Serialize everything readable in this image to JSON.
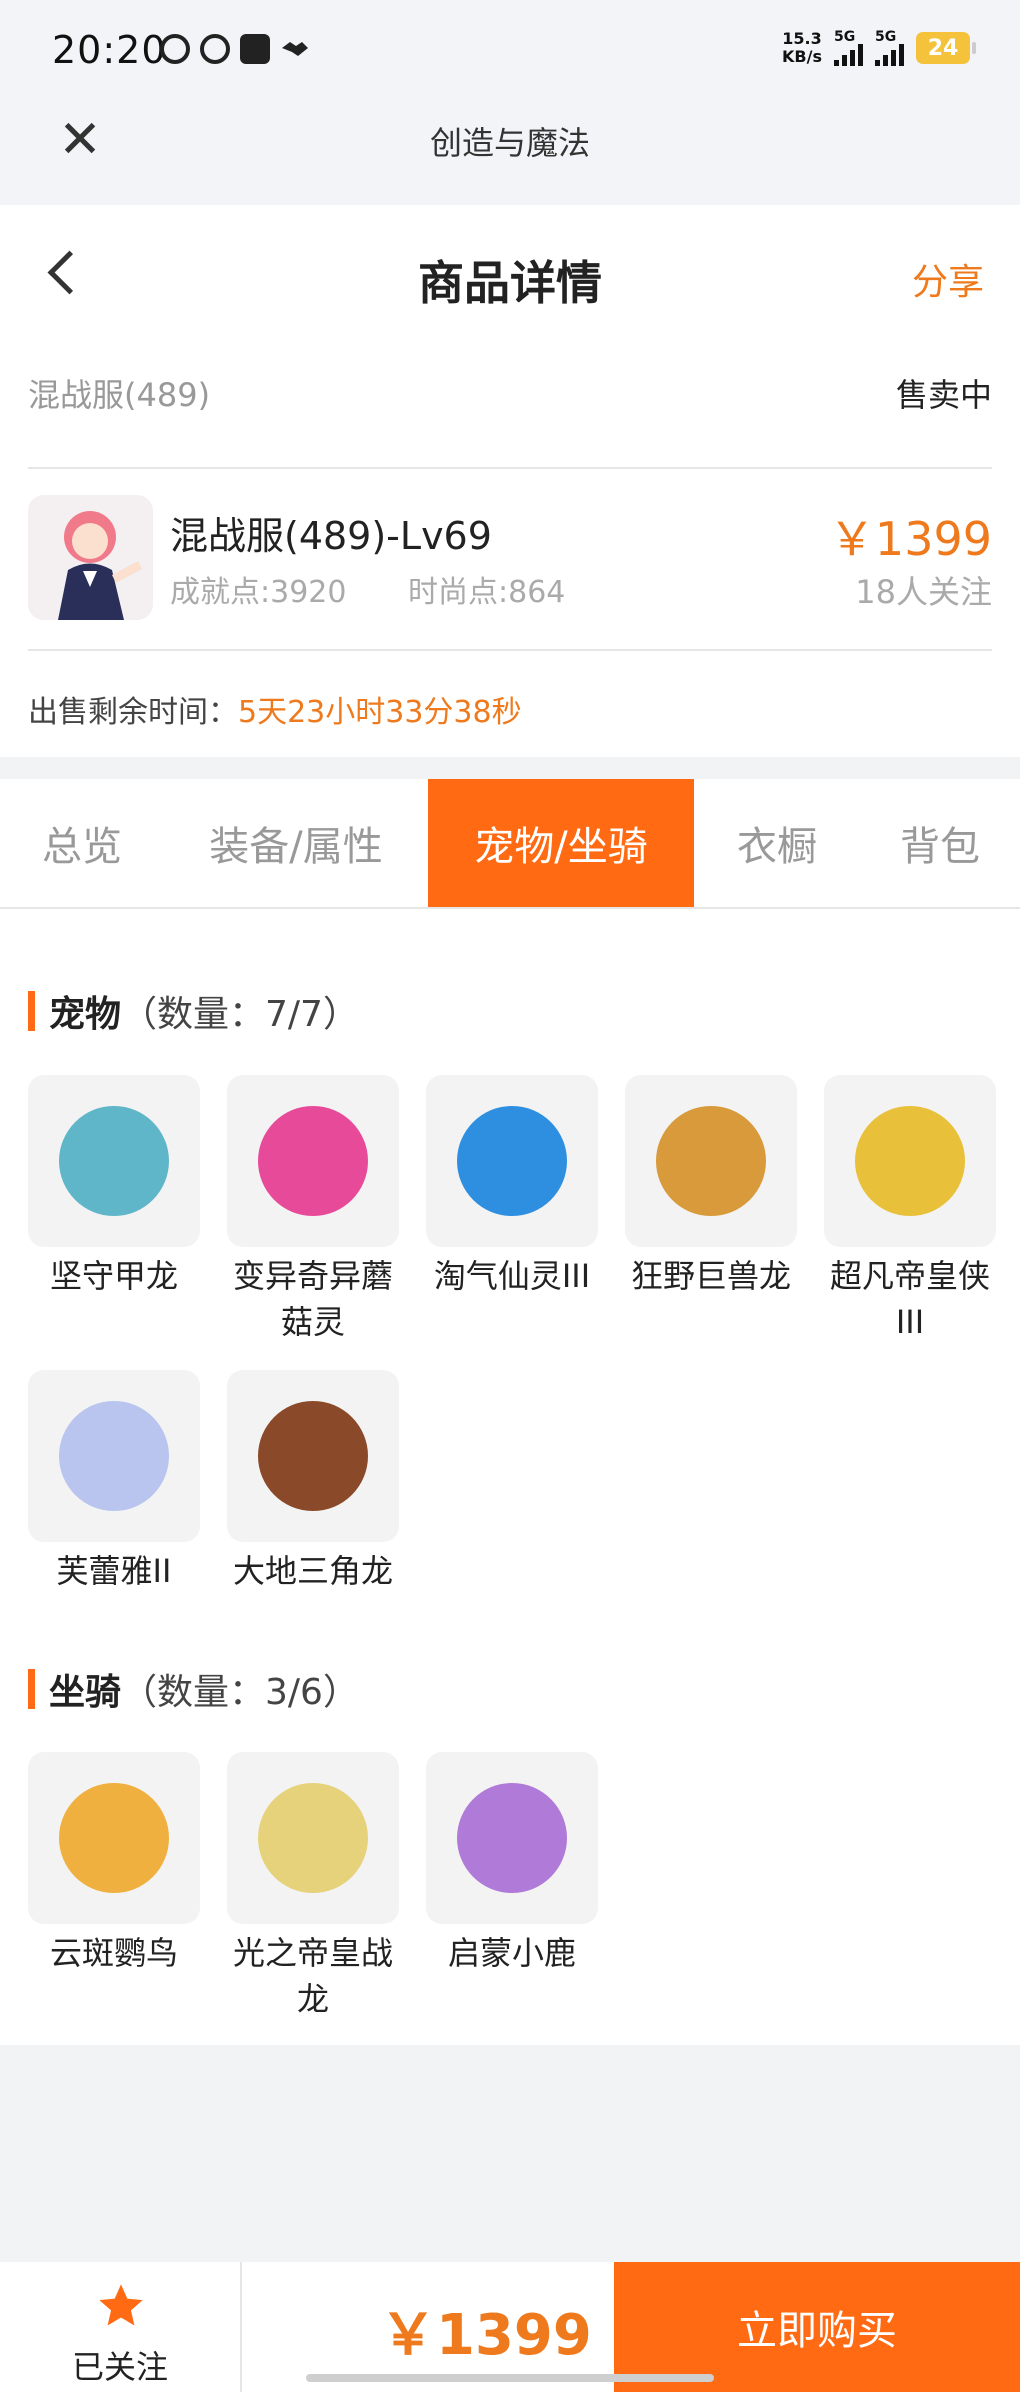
{
  "status_bar": {
    "time": "20:20",
    "speed_value": "15.3",
    "speed_unit": "KB/s",
    "signal1": "5G",
    "signal2": "5G",
    "battery": "24"
  },
  "app_header": {
    "title": "创造与魔法",
    "close_icon": "close-icon"
  },
  "nav": {
    "title": "商品详情",
    "share": "分享"
  },
  "server": {
    "name": "混战服(489)",
    "status": "售卖中"
  },
  "item": {
    "title": "混战服(489)-Lv69",
    "achievement": "成就点:3920",
    "fashion": "时尚点:864",
    "price": "￥1399",
    "followers": "18人关注"
  },
  "remaining": {
    "label": "出售剩余时间：",
    "value": "5天23小时33分38秒"
  },
  "tabs": [
    {
      "label": "总览"
    },
    {
      "label": "装备/属性"
    },
    {
      "label": "宠物/坐骑"
    },
    {
      "label": "衣橱"
    },
    {
      "label": "背包"
    }
  ],
  "active_tab": 2,
  "pets": {
    "title": "宠物",
    "count": "（数量：7/7）",
    "items": [
      {
        "name": "坚守甲龙",
        "color": "#5fb6c9"
      },
      {
        "name": "变异奇异蘑菇灵",
        "color": "#e84a9a"
      },
      {
        "name": "淘气仙灵III",
        "color": "#2e8fe0"
      },
      {
        "name": "狂野巨兽龙",
        "color": "#d89a3a"
      },
      {
        "name": "超凡帝皇侠III",
        "color": "#e8c03a"
      },
      {
        "name": "芙蕾雅II",
        "color": "#b9c4ef"
      },
      {
        "name": "大地三角龙",
        "color": "#8a4a2a"
      }
    ]
  },
  "mounts": {
    "title": "坐骑",
    "count": "（数量：3/6）",
    "items": [
      {
        "name": "云斑鹦鸟",
        "color": "#f0b040"
      },
      {
        "name": "光之帝皇战龙",
        "color": "#e6d27a"
      },
      {
        "name": "启蒙小鹿",
        "color": "#b07ad8"
      }
    ]
  },
  "bottom": {
    "follow_label": "已关注",
    "price": "￥1399",
    "buy": "立即购买"
  },
  "colors": {
    "accent": "#ff6a13",
    "price": "#ee7a1d"
  }
}
